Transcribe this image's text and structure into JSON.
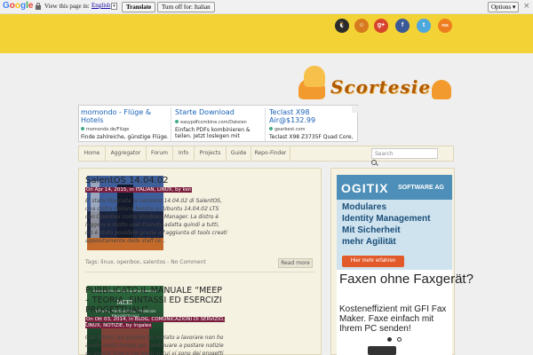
{
  "translate_bar": {
    "logo": [
      "G",
      "o",
      "o",
      "g",
      "l",
      "e"
    ],
    "prompt": "View this page in:",
    "language": "English",
    "language_caret": "▾",
    "translate_button": "Translate",
    "turn_off_button": "Turn off for: Italian",
    "options_button": "Options ▾",
    "close": "×"
  },
  "header": {
    "social_icons": [
      "tux-icon",
      "google-plus-icon",
      "facebook-icon",
      "twitter-icon",
      "rss-icon"
    ],
    "social_labels": [
      "🐧",
      "g+",
      "f",
      "t",
      "rss"
    ],
    "logo_text": "Scortesie"
  },
  "ads_top": [
    {
      "title": "momondo - Flüge & Hotels",
      "source": "momondo.de/Flüge",
      "desc": "Finde zahlreiche, günstige Flüge."
    },
    {
      "title": "Starte Download",
      "source": "easypdfcombine.com/Dateien",
      "desc": "Einfach PDFs kombinieren & teilen. Jetzt loslegen mit"
    },
    {
      "title": "Teclast X98 Air@$132.99",
      "source": "gearbest.com",
      "desc": "Teclast X98 Z3735F Quad Core,"
    }
  ],
  "nav": {
    "items": [
      "Home",
      "Aggregator",
      "Forum",
      "Info",
      "Projects",
      "Guide",
      "Repo-Finder"
    ],
    "search_placeholder": "Search"
  },
  "posts": [
    {
      "title": "SalentOS 14.04.02",
      "meta": "On Apr 14, 2015, in ITALIAN, LINUX, by ken",
      "body": "E' stata rilasciata la versione 14.04.02 di SalentOS, una distro italiana basata su Ubuntu 14.04.02 LTS con Openbox come Windows Manager. La distro è leggera e molto user-friendly adatta quindi a tutti, ciò è stato possibile grazie all'aggiunta di tools creati appositamente dallo staff (è…",
      "tags": "Tags: linux, openbox, salentos - No Comment",
      "read_more": "Read more"
    },
    {
      "title": "PUBBLICATO IL MANUALE “MEEP – TEORIA, SINTASSI ED ESERCIZI PROGETTUALI”",
      "meta": "On Ott 03, 2014, in BLOG, COMUNICAZIONI DI SERVIZIO, LINUX, NOTIZIE, by Ingalex",
      "body": "Cari lettori, da quando ho iniziato a lavorare non ho avuto molto tempo per continuare a postare notizie su questo blog e nei posti in cui vi sono dei progetti attivi.",
      "cover_authors": "Antonio Boccia  Alessandro Laurenti",
      "cover_title": "MEEP",
      "cover_subtitle": "TEORIA, SINTASSI ED ESERCIZI PROGETTUALI"
    }
  ],
  "sidebar_ad1": {
    "brand": "OGITIX",
    "tag": "SOFTWARE AG",
    "lines": [
      "Modulares",
      "Identity Management",
      "Mit Sicherheit",
      "mehr Agilität"
    ],
    "button": "Hier mehr erfahren"
  },
  "sidebar_ad2": {
    "title": "Faxen ohne Faxgerät?",
    "desc": "Kosteneffizient mit GFI Fax Maker. Faxe einfach mit Ihrem PC senden!"
  },
  "colors": {
    "header_yellow": "#f2d234",
    "meta_bg": "#7a1c3c",
    "panel_bg": "#f6f2e2"
  }
}
